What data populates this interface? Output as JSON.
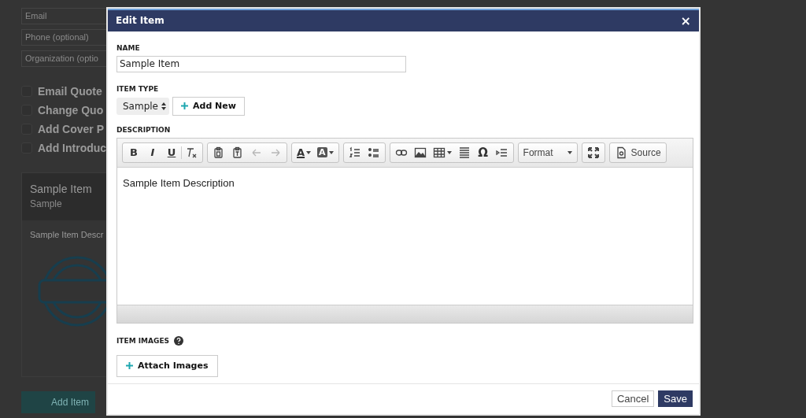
{
  "background_page": {
    "fields": [
      {
        "placeholder": "Email"
      },
      {
        "placeholder": "Phone (optional)"
      },
      {
        "placeholder": "Organization (optio"
      }
    ],
    "options": [
      {
        "label": "Email Quote",
        "checked": false
      },
      {
        "label": "Change Quo",
        "checked": false
      },
      {
        "label": "Add Cover P",
        "checked": false
      },
      {
        "label": "Add Introduc",
        "checked": false
      }
    ],
    "item_card": {
      "title": "Sample Item",
      "type": "Sample",
      "description": "Sample Item Descr"
    },
    "add_item_button": "Add Item"
  },
  "dialog": {
    "title": "Edit Item",
    "close": "×",
    "name": {
      "label": "NAME",
      "value": "Sample Item"
    },
    "item_type": {
      "label": "ITEM TYPE",
      "value": "Sample",
      "add_button": "Add New"
    },
    "description": {
      "label": "DESCRIPTION",
      "text": "Sample Item Description",
      "toolbar": {
        "bold": "B",
        "italic": "I",
        "underline": "U",
        "text_color": "A",
        "background_color": "A",
        "special_character": "Ω",
        "format": "Format",
        "source": "Source",
        "undo": {
          "disabled": true
        },
        "redo": {
          "disabled": true
        }
      }
    },
    "item_images": {
      "label": "ITEM IMAGES",
      "attach_button": "Attach Images"
    },
    "buttons": [
      {
        "label": "Cancel",
        "kind": "secondary"
      },
      {
        "label": "Save",
        "kind": "primary"
      }
    ]
  }
}
